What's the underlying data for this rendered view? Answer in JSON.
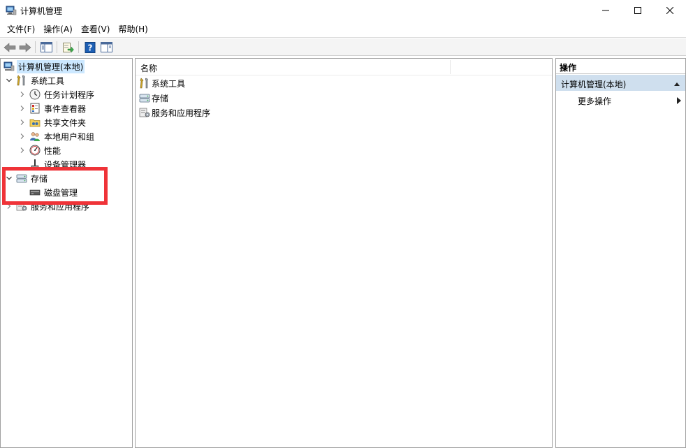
{
  "window": {
    "title": "计算机管理"
  },
  "menubar": [
    {
      "label": "文件(F)"
    },
    {
      "label": "操作(A)"
    },
    {
      "label": "查看(V)"
    },
    {
      "label": "帮助(H)"
    }
  ],
  "tree": {
    "root": "计算机管理(本地)",
    "system_tools": "系统工具",
    "task_scheduler": "任务计划程序",
    "event_viewer": "事件查看器",
    "shared_folders": "共享文件夹",
    "local_users": "本地用户和组",
    "performance": "性能",
    "device_manager": "设备管理器",
    "storage": "存储",
    "disk_management": "磁盘管理",
    "services_apps": "服务和应用程序"
  },
  "center": {
    "column_name": "名称",
    "items": [
      {
        "label": "系统工具",
        "icon": "tools-icon"
      },
      {
        "label": "存储",
        "icon": "storage-icon"
      },
      {
        "label": "服务和应用程序",
        "icon": "services-icon"
      }
    ]
  },
  "actions": {
    "title": "操作",
    "section": "计算机管理(本地)",
    "more": "更多操作"
  },
  "colors": {
    "highlight": "#ef3338",
    "selection": "#cce8ff",
    "actions_section": "#cfdfee"
  }
}
